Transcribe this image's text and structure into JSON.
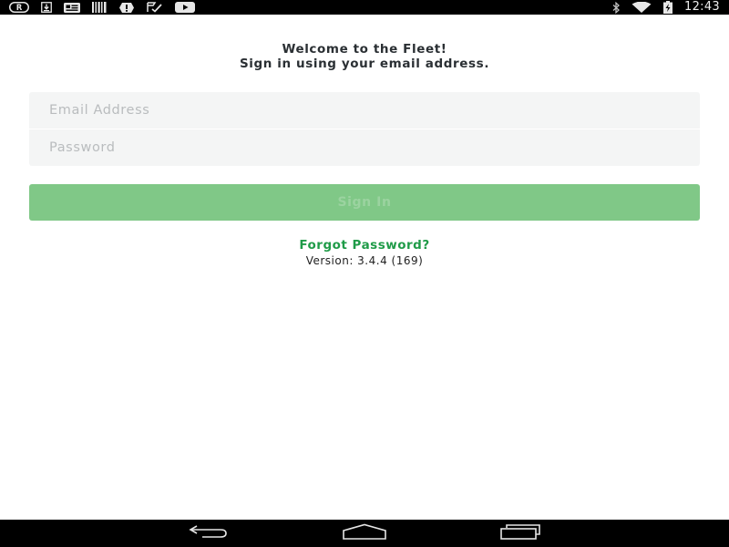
{
  "status_bar": {
    "time": "12:43",
    "left_icons": [
      "registered-icon",
      "download-icon",
      "news-icon",
      "barcode-icon",
      "alert-icon",
      "check-flag-icon",
      "youtube-icon"
    ],
    "right_icons": [
      "bluetooth-icon",
      "wifi-icon",
      "battery-charging-icon"
    ]
  },
  "header": {
    "line1": "Welcome to the Fleet!",
    "line2": "Sign in using your email address."
  },
  "form": {
    "email_placeholder": "Email Address",
    "email_value": "",
    "password_placeholder": "Password",
    "password_value": "",
    "sign_in_label": "Sign In"
  },
  "links": {
    "forgot_password": "Forgot Password?"
  },
  "footer": {
    "version": "Version: 3.4.4 (169)"
  },
  "nav_bar": {
    "buttons": [
      "back-icon",
      "home-icon",
      "recents-icon"
    ]
  },
  "colors": {
    "status_bar_bg": "#000000",
    "input_bg": "#f4f5f5",
    "sign_in_bg": "#80c887",
    "sign_in_text": "#9bd3a0",
    "link": "#1f9b48",
    "heading": "#2a2f33"
  }
}
